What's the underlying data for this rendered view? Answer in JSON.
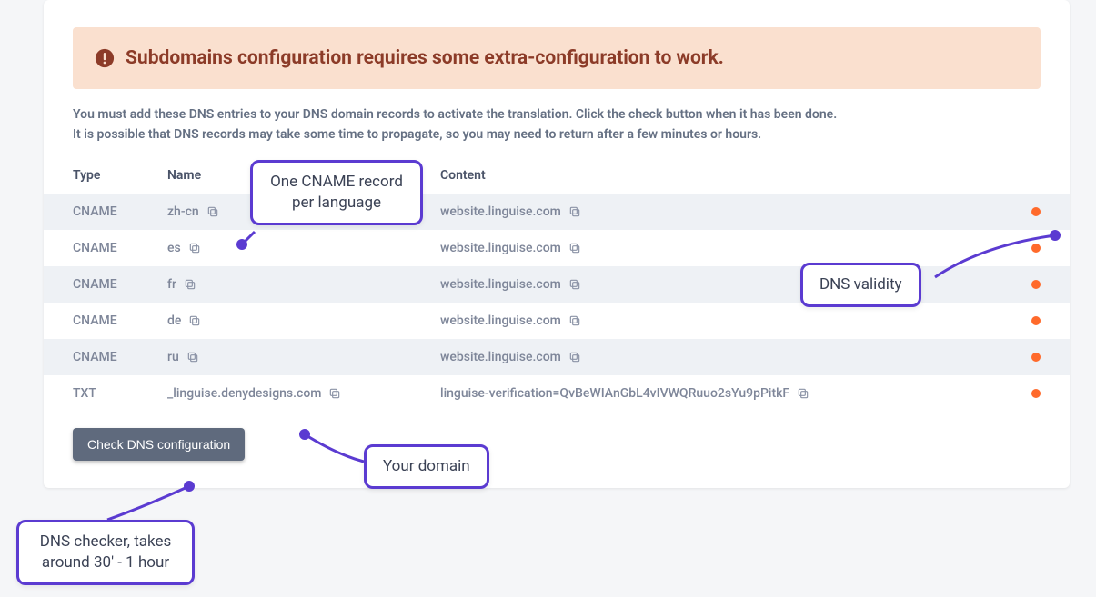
{
  "alert": {
    "text": "Subdomains configuration requires some extra-configuration to work."
  },
  "instructions": {
    "line1": "You must add these DNS entries to your DNS domain records to activate the translation. Click the check button when it has been done.",
    "line2": "It is possible that DNS records may take some time to propagate, so you may need to return after a few minutes or hours."
  },
  "table": {
    "headers": {
      "type": "Type",
      "name": "Name",
      "content": "Content"
    },
    "rows": [
      {
        "type": "CNAME",
        "name": "zh-cn",
        "content": "website.linguise.com"
      },
      {
        "type": "CNAME",
        "name": "es",
        "content": "website.linguise.com"
      },
      {
        "type": "CNAME",
        "name": "fr",
        "content": "website.linguise.com"
      },
      {
        "type": "CNAME",
        "name": "de",
        "content": "website.linguise.com"
      },
      {
        "type": "CNAME",
        "name": "ru",
        "content": "website.linguise.com"
      },
      {
        "type": "TXT",
        "name": "_linguise.denydesigns.com",
        "content": "linguise-verification=QvBeWIAnGbL4vIVWQRuuo2sYu9pPitkF"
      }
    ]
  },
  "button": {
    "label": "Check DNS configuration"
  },
  "callouts": {
    "cname": "One CNAME record per language",
    "validity": "DNS validity",
    "domain": "Your domain",
    "checker": "DNS checker, takes around 30' - 1 hour"
  },
  "colors": {
    "accent": "#5b3bd1",
    "status_dot": "#ff6a2b",
    "alert_bg": "#fae0cf",
    "alert_text": "#8c3b28"
  }
}
